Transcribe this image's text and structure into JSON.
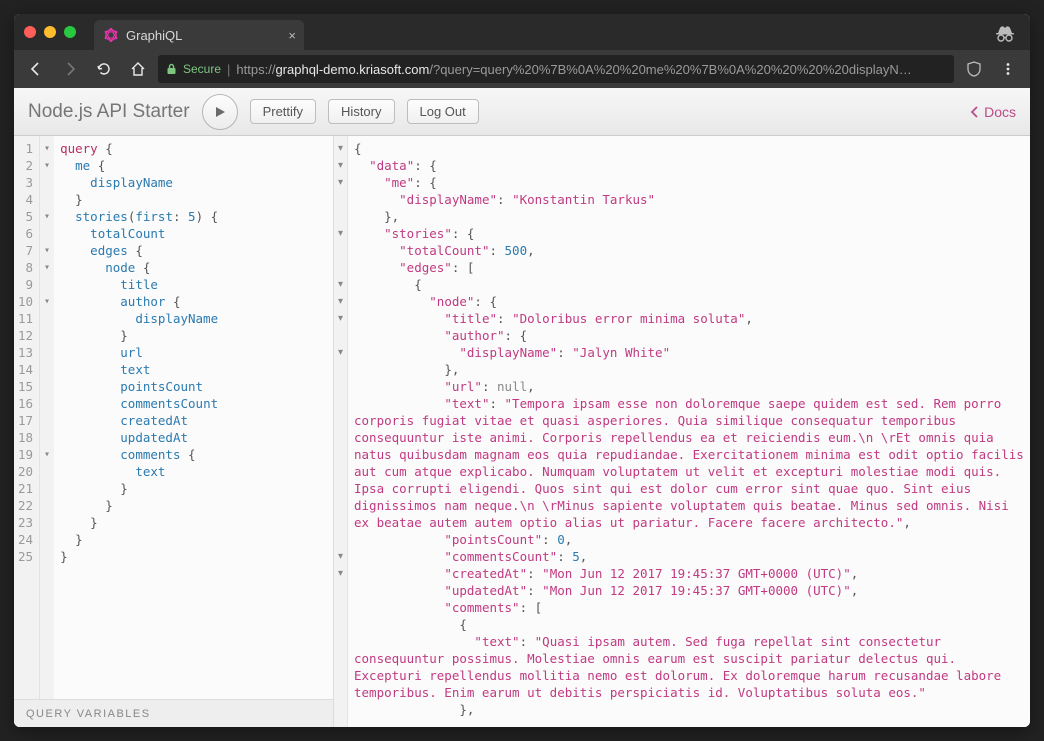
{
  "browser": {
    "tab": {
      "title": "GraphiQL",
      "favicon_color": "#e535ab"
    },
    "address": {
      "secure_label": "Secure",
      "scheme": "https://",
      "host": "graphql-demo.kriasoft.com",
      "path": "/?query=query%20%7B%0A%20%20me%20%7B%0A%20%20%20%20displayN…"
    },
    "nav": {
      "back": "←",
      "forward": "→",
      "reload": "⟳",
      "home": "⌂"
    }
  },
  "graphiql": {
    "title": "Node.js API Starter",
    "buttons": {
      "prettify": "Prettify",
      "history": "History",
      "logout": "Log Out",
      "docs": "Docs"
    },
    "query_lines": [
      [
        [
          "kw",
          "query"
        ],
        [
          "punct",
          " {"
        ]
      ],
      [
        [
          "punct",
          "  "
        ],
        [
          "fld",
          "me"
        ],
        [
          "punct",
          " {"
        ]
      ],
      [
        [
          "punct",
          "    "
        ],
        [
          "fld",
          "displayName"
        ]
      ],
      [
        [
          "punct",
          "  }"
        ]
      ],
      [
        [
          "punct",
          "  "
        ],
        [
          "fld",
          "stories"
        ],
        [
          "punct",
          "("
        ],
        [
          "fld",
          "first"
        ],
        [
          "punct",
          ": "
        ],
        [
          "num",
          "5"
        ],
        [
          "punct",
          ") {"
        ]
      ],
      [
        [
          "punct",
          "    "
        ],
        [
          "fld",
          "totalCount"
        ]
      ],
      [
        [
          "punct",
          "    "
        ],
        [
          "fld",
          "edges"
        ],
        [
          "punct",
          " {"
        ]
      ],
      [
        [
          "punct",
          "      "
        ],
        [
          "fld",
          "node"
        ],
        [
          "punct",
          " {"
        ]
      ],
      [
        [
          "punct",
          "        "
        ],
        [
          "fld",
          "title"
        ]
      ],
      [
        [
          "punct",
          "        "
        ],
        [
          "fld",
          "author"
        ],
        [
          "punct",
          " {"
        ]
      ],
      [
        [
          "punct",
          "          "
        ],
        [
          "fld",
          "displayName"
        ]
      ],
      [
        [
          "punct",
          "        }"
        ]
      ],
      [
        [
          "punct",
          "        "
        ],
        [
          "fld",
          "url"
        ]
      ],
      [
        [
          "punct",
          "        "
        ],
        [
          "fld",
          "text"
        ]
      ],
      [
        [
          "punct",
          "        "
        ],
        [
          "fld",
          "pointsCount"
        ]
      ],
      [
        [
          "punct",
          "        "
        ],
        [
          "fld",
          "commentsCount"
        ]
      ],
      [
        [
          "punct",
          "        "
        ],
        [
          "fld",
          "createdAt"
        ]
      ],
      [
        [
          "punct",
          "        "
        ],
        [
          "fld",
          "updatedAt"
        ]
      ],
      [
        [
          "punct",
          "        "
        ],
        [
          "fld",
          "comments"
        ],
        [
          "punct",
          " {"
        ]
      ],
      [
        [
          "punct",
          "          "
        ],
        [
          "fld",
          "text"
        ]
      ],
      [
        [
          "punct",
          "        }"
        ]
      ],
      [
        [
          "punct",
          "      }"
        ]
      ],
      [
        [
          "punct",
          "    }"
        ]
      ],
      [
        [
          "punct",
          "  }"
        ]
      ],
      [
        [
          "punct",
          "}"
        ]
      ]
    ],
    "variables_label": "Query Variables",
    "fold_lines_query": [
      1,
      2,
      5,
      7,
      8,
      10,
      19
    ],
    "fold_lines_result": [
      1,
      2,
      3,
      6,
      9,
      10,
      11,
      13,
      25,
      26
    ]
  },
  "response": {
    "data": {
      "me": {
        "displayName": "Konstantin Tarkus"
      },
      "stories": {
        "totalCount": 500,
        "edges": [
          {
            "node": {
              "title": "Doloribus error minima soluta",
              "author": {
                "displayName": "Jalyn White"
              },
              "url": null,
              "text": "Tempora ipsam esse non doloremque saepe quidem est sed. Rem porro corporis fugiat vitae et quasi asperiores. Quia similique consequatur temporibus consequuntur iste animi. Corporis repellendus ea et reiciendis eum.\\n \\rEt omnis quia natus quibusdam magnam eos quia repudiandae. Exercitationem minima est odit optio facilis aut cum atque explicabo. Numquam voluptatem ut velit et excepturi molestiae modi quis. Ipsa corrupti eligendi. Quos sint qui est dolor cum error sint quae quo. Sint eius dignissimos nam neque.\\n \\rMinus sapiente voluptatem quis beatae. Minus sed omnis. Nisi ex beatae autem autem optio alias ut pariatur. Facere facere architecto.",
              "pointsCount": 0,
              "commentsCount": 5,
              "createdAt": "Mon Jun 12 2017 19:45:37 GMT+0000 (UTC)",
              "updatedAt": "Mon Jun 12 2017 19:45:37 GMT+0000 (UTC)",
              "comments": [
                {
                  "text": "Quasi ipsam autem. Sed fuga repellat sint consectetur consequuntur possimus. Molestiae omnis earum est suscipit pariatur delectus qui. Excepturi repellendus mollitia nemo est dolorum. Ex doloremque harum recusandae labore temporibus. Enim earum ut debitis perspiciatis id. Voluptatibus soluta eos."
                }
              ]
            }
          }
        ]
      }
    }
  }
}
